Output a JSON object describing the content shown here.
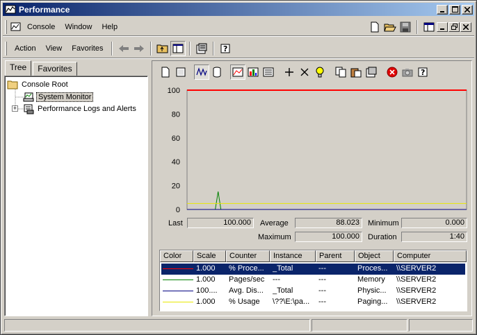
{
  "window": {
    "title": "Performance"
  },
  "menubar": {
    "items": [
      "Console",
      "Window",
      "Help"
    ]
  },
  "actionbar": {
    "items": [
      "Action",
      "View",
      "Favorites"
    ]
  },
  "tabs": [
    "Tree",
    "Favorites"
  ],
  "tree": {
    "root": "Console Root",
    "items": [
      "System Monitor",
      "Performance Logs and Alerts"
    ]
  },
  "stats": {
    "last_label": "Last",
    "last": "100.000",
    "average_label": "Average",
    "average": "88.023",
    "minimum_label": "Minimum",
    "minimum": "0.000",
    "maximum_label": "Maximum",
    "maximum": "100.000",
    "duration_label": "Duration",
    "duration": "1:40"
  },
  "legend": {
    "columns": [
      "Color",
      "Scale",
      "Counter",
      "Instance",
      "Parent",
      "Object",
      "Computer"
    ],
    "rows": [
      {
        "color": "#ff0000",
        "scale": "1.000",
        "counter": "% Proce...",
        "instance": "_Total",
        "parent": "---",
        "object": "Proces...",
        "computer": "\\\\SERVER2"
      },
      {
        "color": "#008000",
        "scale": "1.000",
        "counter": "Pages/sec",
        "instance": "---",
        "parent": "---",
        "object": "Memory",
        "computer": "\\\\SERVER2"
      },
      {
        "color": "#000080",
        "scale": "100....",
        "counter": "Avg. Dis...",
        "instance": "_Total",
        "parent": "---",
        "object": "Physic...",
        "computer": "\\\\SERVER2"
      },
      {
        "color": "#e8e800",
        "scale": "1.000",
        "counter": "% Usage",
        "instance": "\\??\\E:\\pa...",
        "parent": "---",
        "object": "Paging...",
        "computer": "\\\\SERVER2"
      }
    ]
  },
  "chart_data": {
    "type": "line",
    "ylim": [
      0,
      100
    ],
    "yticks": [
      "100",
      "80",
      "60",
      "40",
      "20",
      "0"
    ],
    "x": [
      0,
      1,
      2,
      3,
      4,
      5,
      6,
      7,
      8,
      9,
      10,
      11,
      12,
      13,
      14,
      15,
      16,
      17,
      18,
      19,
      20,
      21,
      22,
      23,
      24,
      25,
      26,
      27,
      28,
      29,
      30,
      31,
      32,
      33,
      34,
      35,
      36,
      37,
      38,
      39,
      40,
      41,
      42,
      43,
      44,
      45,
      46,
      47,
      48,
      49,
      50,
      51,
      52,
      53,
      54,
      55,
      56,
      57,
      58,
      59,
      60,
      61,
      62,
      63,
      64,
      65,
      66,
      67,
      68,
      69,
      70,
      71,
      72,
      73,
      74,
      75,
      76,
      77,
      78,
      79,
      80,
      81,
      82,
      83,
      84,
      85,
      86,
      87,
      88,
      89,
      90,
      91,
      92,
      93,
      94,
      95,
      96,
      97,
      98,
      99
    ],
    "series": [
      {
        "color": "#ff0000",
        "values": [
          100,
          100,
          100,
          100,
          100,
          100,
          100,
          100,
          100,
          100,
          100,
          100,
          100,
          100,
          100,
          100,
          100,
          100,
          100,
          100,
          100,
          100,
          100,
          100,
          100,
          100,
          100,
          100,
          100,
          100,
          100,
          100,
          100,
          100,
          100,
          100,
          100,
          100,
          100,
          100,
          100,
          100,
          100,
          100,
          100,
          100,
          100,
          100,
          100,
          100,
          100,
          100,
          100,
          100,
          100,
          100,
          100,
          100,
          100,
          100,
          100,
          100,
          100,
          100,
          100,
          100,
          100,
          100,
          100,
          100,
          100,
          100,
          100,
          100,
          100,
          100,
          100,
          100,
          100,
          100,
          100,
          100,
          100,
          100,
          100,
          100,
          100,
          100,
          100,
          100,
          100,
          100,
          100,
          100,
          100,
          100,
          100,
          100,
          100,
          100
        ]
      },
      {
        "color": "#008000",
        "values": [
          0,
          0,
          0,
          0,
          0,
          0,
          0,
          0,
          0,
          0,
          0,
          15,
          0,
          0,
          0,
          0,
          0,
          0,
          0,
          0,
          0,
          0,
          0,
          0,
          0,
          0,
          0,
          0,
          0,
          0,
          0,
          0,
          0,
          0,
          0,
          0,
          0,
          0,
          0,
          0,
          0,
          0,
          0,
          0,
          0,
          0,
          0,
          0,
          0,
          0,
          0,
          0,
          0,
          0,
          0,
          0,
          0,
          0,
          0,
          0,
          0,
          0,
          0,
          0,
          0,
          0,
          0,
          0,
          0,
          0,
          0,
          0,
          0,
          0,
          0,
          0,
          0,
          0,
          0,
          0,
          0,
          0,
          0,
          0,
          0,
          0,
          0,
          0,
          0,
          0,
          0,
          0,
          0,
          0,
          0,
          0,
          0,
          0,
          0,
          0
        ]
      },
      {
        "color": "#000080",
        "values": [
          0,
          0,
          0,
          0,
          0,
          0,
          0,
          0,
          0,
          0,
          0,
          0,
          0,
          0,
          0,
          0,
          0,
          0,
          0,
          0,
          0,
          0,
          0,
          0,
          0,
          0,
          0,
          0,
          0,
          0,
          0,
          0,
          0,
          0,
          0,
          0,
          0,
          0,
          0,
          0,
          0,
          0,
          0,
          0,
          0,
          0,
          0,
          0,
          0,
          0,
          0,
          0,
          0,
          0,
          0,
          0,
          0,
          0,
          0,
          0,
          0,
          0,
          0,
          0,
          0,
          0,
          0,
          0,
          0,
          0,
          0,
          0,
          0,
          0,
          0,
          0,
          0,
          0,
          0,
          0,
          0,
          0,
          0,
          0,
          0,
          0,
          0,
          0,
          0,
          0,
          0,
          0,
          0,
          0,
          0,
          0,
          0,
          0,
          0,
          0
        ]
      },
      {
        "color": "#e8e800",
        "values": [
          5,
          5,
          5,
          5,
          5,
          5,
          5,
          5,
          5,
          5,
          5,
          5,
          5,
          5,
          5,
          5,
          5,
          5,
          5,
          5,
          5,
          5,
          5,
          5,
          5,
          5,
          5,
          5,
          5,
          5,
          5,
          5,
          5,
          5,
          5,
          5,
          5,
          5,
          5,
          5,
          5,
          5,
          5,
          5,
          5,
          5,
          5,
          5,
          5,
          5,
          5,
          5,
          5,
          5,
          5,
          5,
          5,
          5,
          5,
          5,
          5,
          5,
          5,
          5,
          5,
          5,
          5,
          5,
          5,
          5,
          5,
          5,
          5,
          5,
          5,
          5,
          5,
          5,
          5,
          5,
          5,
          5,
          5,
          5,
          5,
          5,
          5,
          5,
          5,
          5,
          5,
          5,
          5,
          5,
          5,
          5,
          5,
          5,
          5,
          5
        ]
      }
    ]
  }
}
